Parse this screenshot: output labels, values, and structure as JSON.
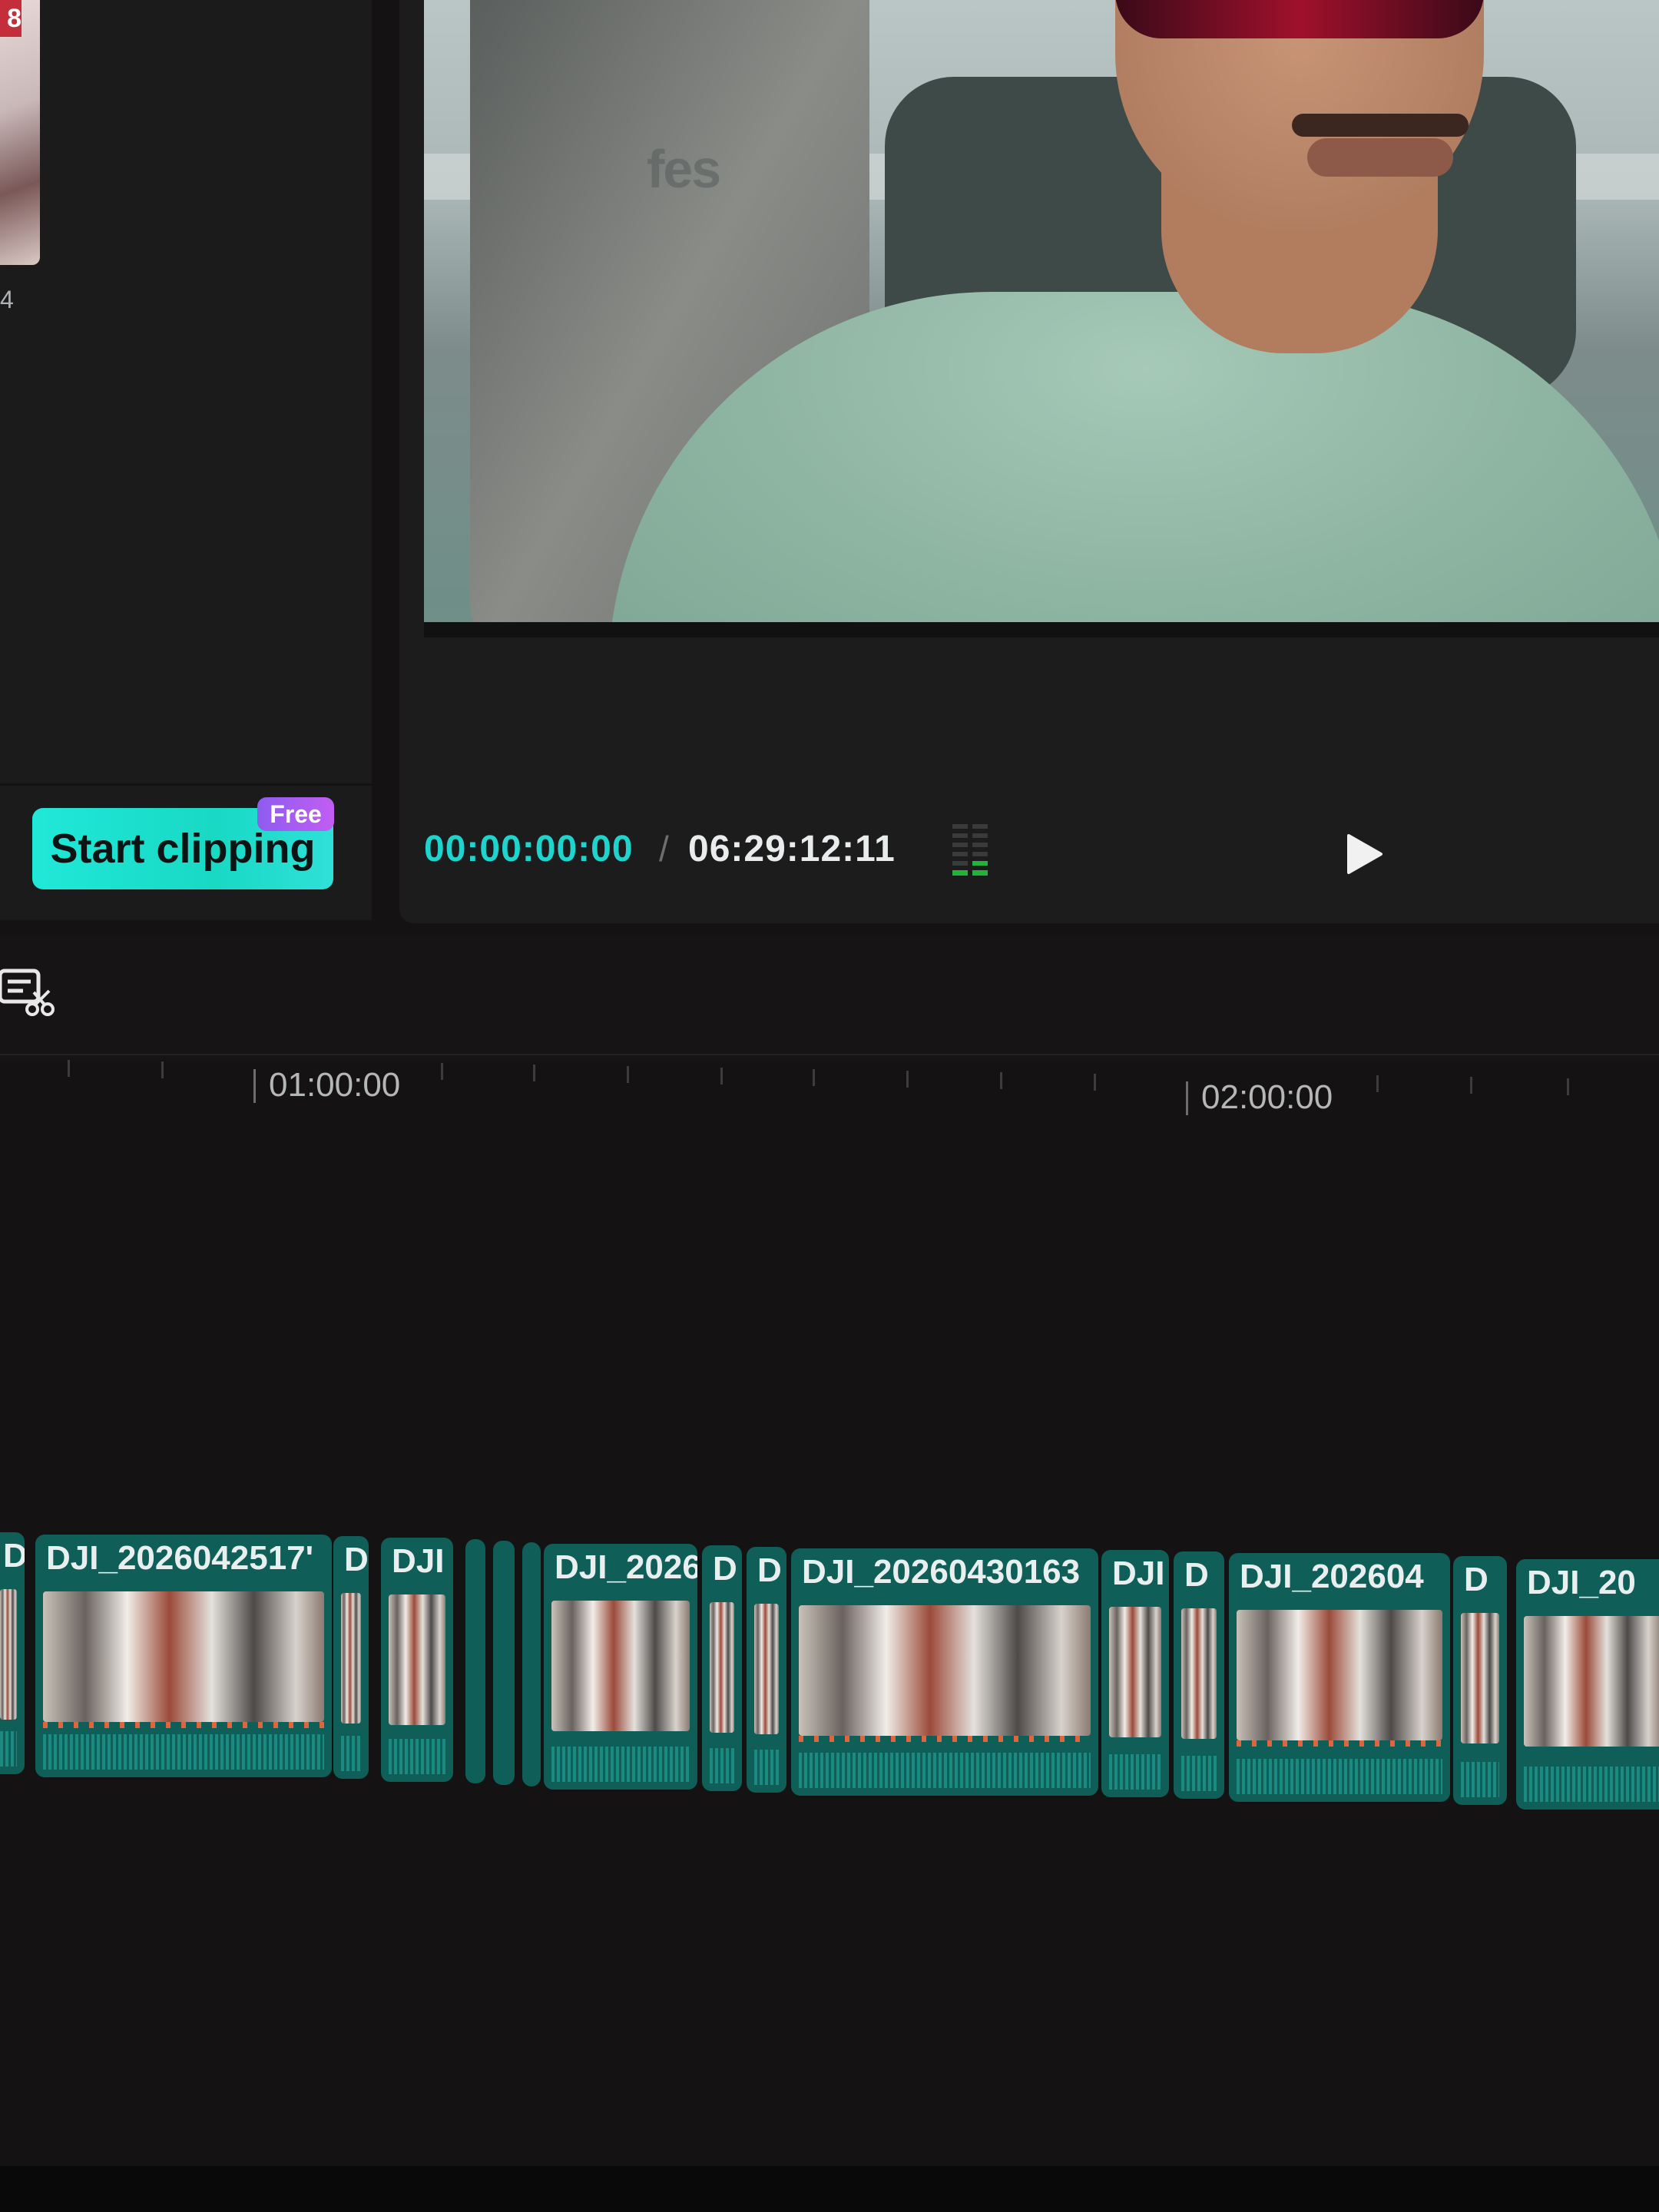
{
  "media_panel": {
    "thumb_badge": "8",
    "thumb_duration": "4",
    "start_clipping_label": "Start clipping",
    "free_badge": "Free"
  },
  "player": {
    "current_time": "00:00:00:00",
    "separator": "/",
    "total_time": "06:29:12:11"
  },
  "video_frame": {
    "sign_text": "fes"
  },
  "ruler": {
    "labels": [
      "01:00:00",
      "02:00:00"
    ]
  },
  "track": {
    "clips": [
      {
        "label": "D"
      },
      {
        "label": "DJI_2026042517'"
      },
      {
        "label": "D"
      },
      {
        "label": "DJI"
      },
      {
        "label": ""
      },
      {
        "label": ""
      },
      {
        "label": "DJI_2026"
      },
      {
        "label": "D"
      },
      {
        "label": "D"
      },
      {
        "label": "DJI_20260430163"
      },
      {
        "label": "DJI"
      },
      {
        "label": "D"
      },
      {
        "label": "DJI_202604"
      },
      {
        "label": "D"
      },
      {
        "label": "DJI_20"
      }
    ]
  },
  "colors": {
    "accent_teal": "#1fd4cd",
    "clip_teal": "#0f5e58",
    "free_badge_purple": "#9b5cf0"
  }
}
